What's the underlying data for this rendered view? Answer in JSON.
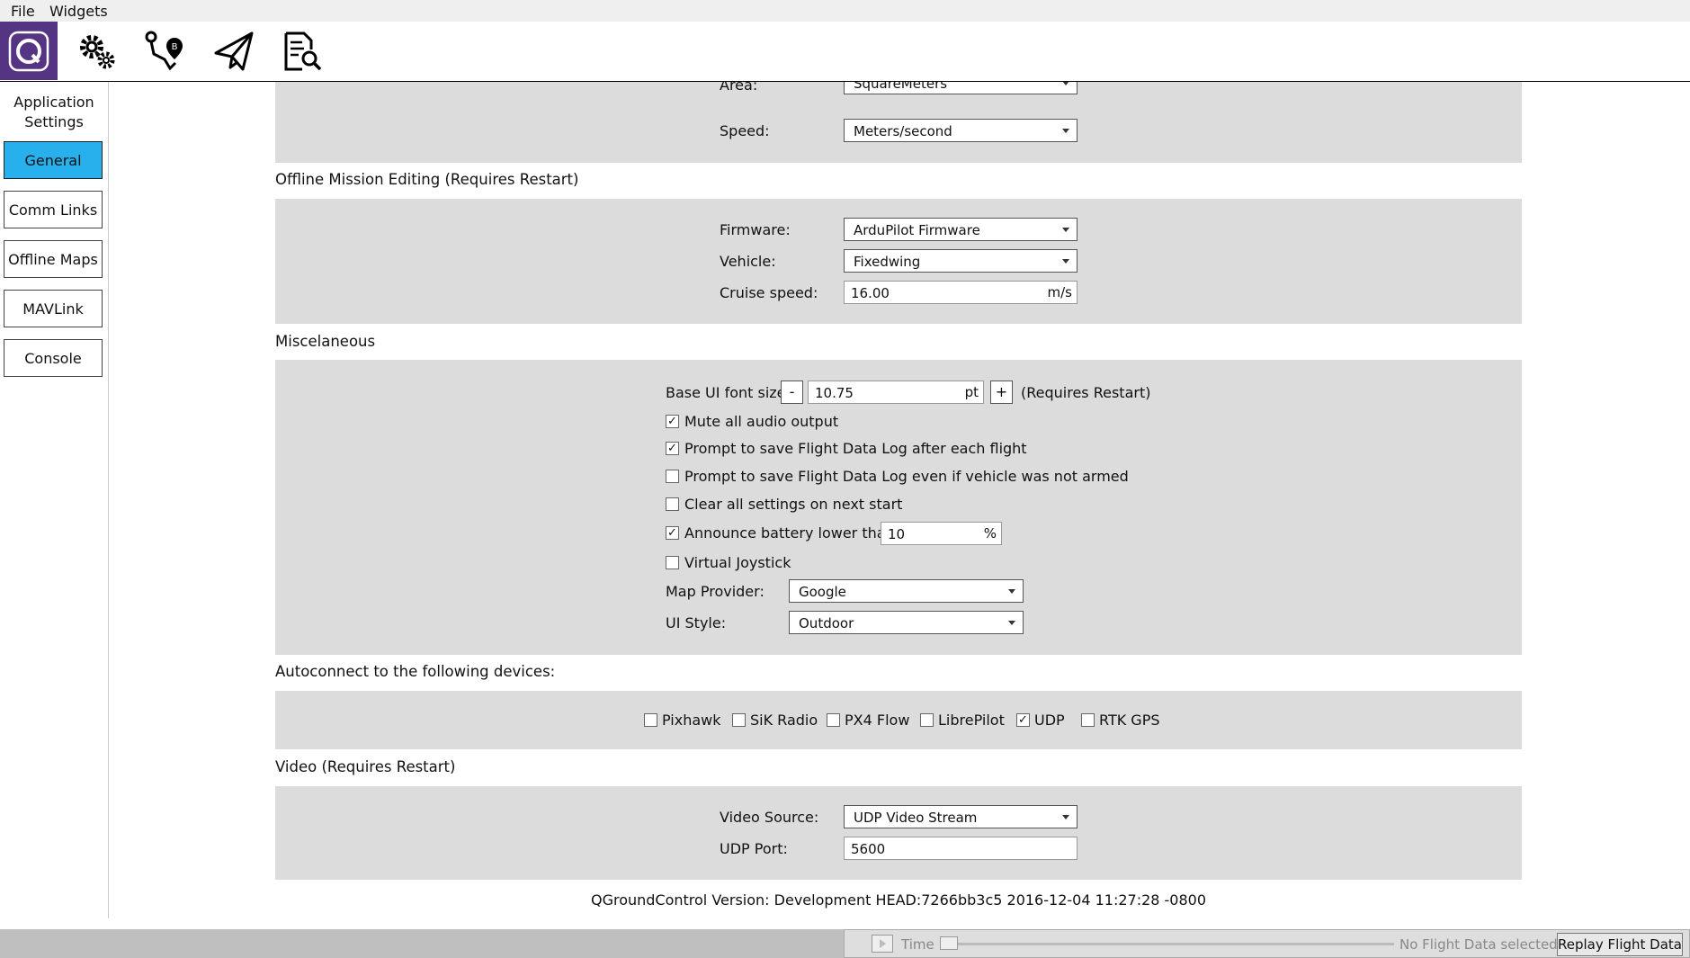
{
  "menu": {
    "file": "File",
    "widgets": "Widgets"
  },
  "toolbar": {
    "icons": [
      "qgc-logo-icon",
      "gears-icon",
      "plan-route-icon",
      "fly-paper-plane-icon",
      "analyze-document-icon"
    ]
  },
  "sidebar": {
    "title_line1": "Application",
    "title_line2": "Settings",
    "items": [
      {
        "label": "General",
        "active": true
      },
      {
        "label": "Comm Links"
      },
      {
        "label": "Offline Maps"
      },
      {
        "label": "MAVLink"
      },
      {
        "label": "Console"
      }
    ]
  },
  "units": {
    "area_label": "Area:",
    "area_value": "SquareMeters",
    "speed_label": "Speed:",
    "speed_value": "Meters/second"
  },
  "offline_mission": {
    "title": "Offline Mission Editing (Requires Restart)",
    "firmware_label": "Firmware:",
    "firmware_value": "ArduPilot Firmware",
    "vehicle_label": "Vehicle:",
    "vehicle_value": "Fixedwing",
    "cruise_label": "Cruise speed:",
    "cruise_value": "16.00",
    "cruise_unit": "m/s"
  },
  "misc": {
    "title": "Miscelaneous",
    "font_label": "Base UI font size:",
    "font_minus": "-",
    "font_value": "10.75",
    "font_unit": "pt",
    "font_plus": "+",
    "font_note": "(Requires Restart)",
    "mute_label": "Mute all audio output",
    "mute_checked": true,
    "prompt_label": "Prompt to save Flight Data Log after each flight",
    "prompt_checked": true,
    "prompt_unarmed_label": "Prompt to save Flight Data Log even if vehicle was not armed",
    "prompt_unarmed_checked": false,
    "clear_label": "Clear all settings on next start",
    "clear_checked": false,
    "battery_label": "Announce battery lower than:",
    "battery_checked": true,
    "battery_value": "10",
    "battery_unit": "%",
    "joystick_label": "Virtual Joystick",
    "joystick_checked": false,
    "map_label": "Map Provider:",
    "map_value": "Google",
    "style_label": "UI Style:",
    "style_value": "Outdoor",
    "check_mark": "✓"
  },
  "autoconnect": {
    "title": "Autoconnect to the following devices:",
    "devices": [
      {
        "label": "Pixhawk",
        "checked": false
      },
      {
        "label": "SiK Radio",
        "checked": false
      },
      {
        "label": "PX4 Flow",
        "checked": false
      },
      {
        "label": "LibrePilot",
        "checked": false
      },
      {
        "label": "UDP",
        "checked": true
      },
      {
        "label": "RTK GPS",
        "checked": false
      }
    ]
  },
  "video": {
    "title": "Video (Requires Restart)",
    "source_label": "Video Source:",
    "source_value": "UDP Video Stream",
    "port_label": "UDP Port:",
    "port_value": "5600"
  },
  "version": "QGroundControl Version: Development HEAD:7266bb3c5 2016-12-04 11:27:28 -0800",
  "status": {
    "time_label": "Time",
    "no_data": "No Flight Data selected..",
    "replay_button": "Replay Flight Data"
  },
  "colors": {
    "accent": "#27b0eb",
    "logo_bg": "#553583",
    "panel_bg": "#dcdcdc"
  }
}
